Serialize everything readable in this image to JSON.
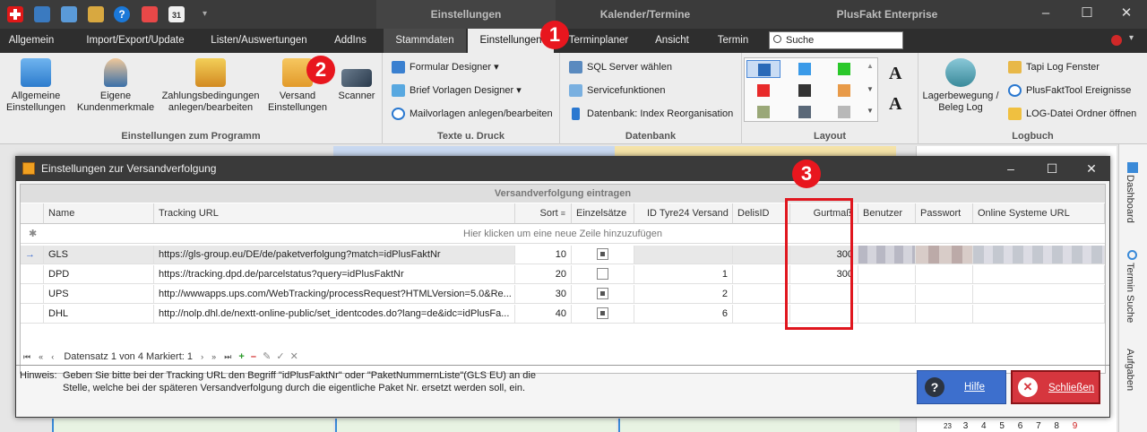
{
  "titlebar": {
    "context_tab1": "Einstellungen",
    "context_tab2": "Kalender/Termine",
    "app_title": "PlusFakt Enterprise",
    "quick_access_badge": "31"
  },
  "tabs": [
    "Allgemein",
    "Import/Export/Update",
    "Listen/Auswertungen",
    "AddIns",
    "Stammdaten",
    "Einstellungen",
    "Terminplaner",
    "Ansicht",
    "Termin"
  ],
  "search": {
    "placeholder": "Suche"
  },
  "ribbon": {
    "group1": {
      "label": "Einstellungen zum Programm",
      "buttons": [
        "Allgemeine Einstellungen",
        "Eigene Kundenmerkmale",
        "Zahlungsbedingungen anlegen/bearbeiten",
        "Versand Einstellungen",
        "Scanner"
      ]
    },
    "group2": {
      "label": "Texte u. Druck",
      "buttons": [
        "Formular Designer",
        "Brief Vorlagen Designer",
        "Mailvorlagen anlegen/bearbeiten"
      ]
    },
    "group3": {
      "label": "Datenbank",
      "buttons": [
        "SQL Server wählen",
        "Servicefunktionen",
        "Datenbank: Index Reorganisation"
      ]
    },
    "group4": {
      "label": "Layout"
    },
    "group5": {
      "label": "Logbuch",
      "big_button": "Lagerbewegung / Beleg Log",
      "buttons": [
        "Tapi Log Fenster",
        "PlusFaktTool Ereignisse",
        "LOG-Datei Ordner öffnen"
      ]
    }
  },
  "sidebar": {
    "items": [
      "Dashboard",
      "Termin Suche",
      "Aufgaben"
    ]
  },
  "calendar": {
    "days": [
      "23",
      "3",
      "4",
      "5",
      "6",
      "7",
      "8",
      "9"
    ]
  },
  "dialog": {
    "title": "Einstellungen zur Versandverfolgung",
    "grid_title": "Versandverfolgung eintragen",
    "columns": [
      "Name",
      "Tracking URL",
      "Sort",
      "Einzelsätze",
      "ID Tyre24 Versand",
      "DelisID",
      "Gurtmaß",
      "Benutzer",
      "Passwort",
      "Online Systeme URL"
    ],
    "new_row_hint": "Hier klicken um eine neue Zeile hinzuzufügen",
    "rows": [
      {
        "name": "GLS",
        "url": "https://gls-group.eu/DE/de/paketverfolgung?match=idPlusFaktNr",
        "sort": "10",
        "einzel": true,
        "tyre": "",
        "delis": "",
        "gurt": "300"
      },
      {
        "name": "DPD",
        "url": "https://tracking.dpd.de/parcelstatus?query=idPlusFaktNr",
        "sort": "20",
        "einzel": false,
        "tyre": "1",
        "delis": "",
        "gurt": "300"
      },
      {
        "name": "UPS",
        "url": "http://wwwapps.ups.com/WebTracking/processRequest?HTMLVersion=5.0&Re...",
        "sort": "30",
        "einzel": true,
        "tyre": "2",
        "delis": "",
        "gurt": ""
      },
      {
        "name": "DHL",
        "url": "http://nolp.dhl.de/nextt-online-public/set_identcodes.do?lang=de&idc=idPlusFa...",
        "sort": "40",
        "einzel": true,
        "tyre": "6",
        "delis": "",
        "gurt": ""
      }
    ],
    "navigator": "Datensatz 1 von 4 Markiert: 1",
    "hint_label": "Hinweis:",
    "hint_text": "Geben Sie bitte bei der Tracking URL den Begriff \"idPlusFaktNr\" oder \"PaketNummernListe\"(GLS EU) an die Stelle, welche bei der späteren Versandverfolgung durch die eigentliche Paket Nr. ersetzt werden soll, ein.",
    "help_button": "Hilfe",
    "close_button": "Schließen"
  },
  "annotations": [
    "1",
    "2",
    "3"
  ],
  "colors": {
    "accent_red": "#e0161e",
    "help_blue": "#3b6fd0",
    "close_red": "#d83a40",
    "title_dark": "#3b3b3b"
  }
}
